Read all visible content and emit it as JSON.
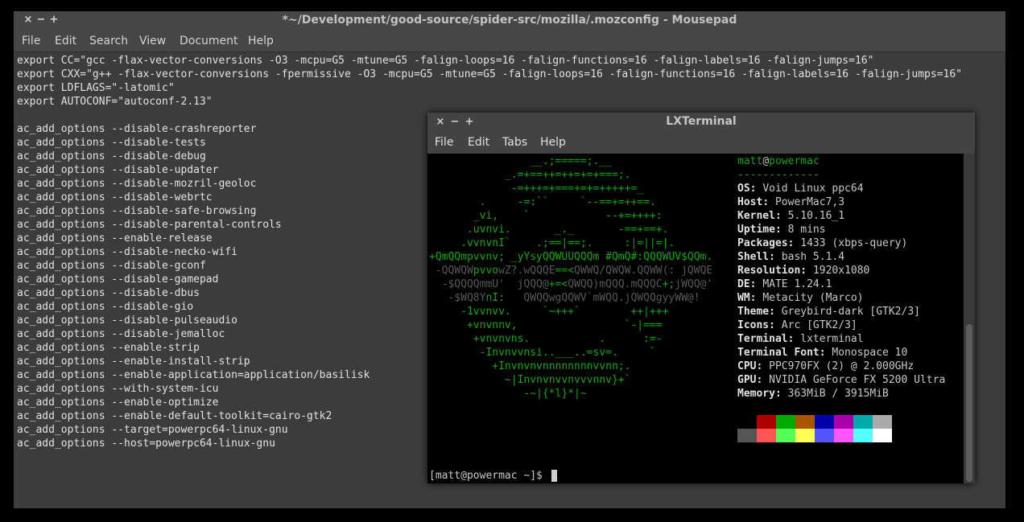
{
  "editor_window": {
    "title": "*~/Development/good-source/spider-src/mozilla/.mozconfig - Mousepad",
    "controls": [
      "×",
      "−",
      "+"
    ],
    "menu": [
      "File",
      "Edit",
      "Search",
      "View",
      "Document",
      "Help"
    ],
    "lines": [
      "export CC=\"gcc -flax-vector-conversions -O3 -mcpu=G5 -mtune=G5 -falign-loops=16 -falign-functions=16 -falign-labels=16 -falign-jumps=16\"",
      "export CXX=\"g++ -flax-vector-conversions -fpermissive -O3 -mcpu=G5 -mtune=G5 -falign-loops=16 -falign-functions=16 -falign-labels=16 -falign-jumps=16\"",
      "export LDFLAGS=\"-latomic\"",
      "export AUTOCONF=\"autoconf-2.13\"",
      "",
      "ac_add_options --disable-crashreporter",
      "ac_add_options --disable-tests",
      "ac_add_options --disable-debug",
      "ac_add_options --disable-updater",
      "ac_add_options --disable-mozril-geoloc",
      "ac_add_options --disable-webrtc",
      "ac_add_options --disable-safe-browsing",
      "ac_add_options --disable-parental-controls",
      "ac_add_options --enable-release",
      "ac_add_options --disable-necko-wifi",
      "ac_add_options --disable-gconf",
      "ac_add_options --disable-gamepad",
      "ac_add_options --disable-dbus",
      "ac_add_options --disable-gio",
      "ac_add_options --disable-pulseaudio",
      "ac_add_options --disable-jemalloc",
      "ac_add_options --enable-strip",
      "ac_add_options --enable-install-strip",
      "ac_add_options --enable-application=application/basilisk",
      "ac_add_options --with-system-icu",
      "ac_add_options --enable-optimize",
      "ac_add_options --enable-default-toolkit=cairo-gtk2",
      "ac_add_options --target=powerpc64-linux-gnu",
      "ac_add_options --host=powerpc64-linux-gnu"
    ]
  },
  "terminal_window": {
    "title": "LXTerminal",
    "controls": [
      "×",
      "−",
      "+"
    ],
    "menu": [
      "File",
      "Edit",
      "Tabs",
      "Help"
    ],
    "ascii_art": [
      [
        [
          "g",
          "                __.;=====;.__"
        ]
      ],
      [
        [
          "g",
          "            _.=+==++=++=+=+===;."
        ]
      ],
      [
        [
          "g",
          "             -=+++=+===+=+=+++++=_"
        ]
      ],
      [
        [
          "g",
          "        .     -=:``     `--==+=++==."
        ]
      ],
      [
        [
          "g",
          "       _vi,    `            --+=++++:"
        ]
      ],
      [
        [
          "g",
          "      .uvnvi.       _._       -==+==+."
        ]
      ],
      [
        [
          "g",
          "     .vvnvnI`    .;==|==;.     :|=||=|."
        ]
      ],
      [
        [
          "g",
          "+QmQQm"
        ],
        [
          "g",
          "pvvnv; _yYsyQQWUUQQQm #QmQ#:QQQWUV$QQm."
        ]
      ],
      [
        [
          "dg",
          " -QQWQW"
        ],
        [
          "g",
          "pvvo"
        ],
        [
          "dg",
          "wZ?.wQQQE"
        ],
        [
          "g",
          "==<"
        ],
        [
          "dg",
          "QWWQ/QWQW.QQWW(: jQWQE"
        ]
      ],
      [
        [
          "dg",
          "  -$QQQQmmU'  jQQQ@"
        ],
        [
          "g",
          "+=<"
        ],
        [
          "dg",
          "QWQQ)mQQQ.mQQQC"
        ],
        [
          "g",
          "+;"
        ],
        [
          "dg",
          "jWQQ@'"
        ]
      ],
      [
        [
          "dg",
          "   -$WQ8Y"
        ],
        [
          "g",
          "nI:"
        ],
        [
          "dg",
          "   QWQQwgQQWV`mWQQ.jQWQQgyyWW@!"
        ]
      ],
      [
        [
          "g",
          "     -1vvnvv.     `~+++`        ++|+++"
        ]
      ],
      [
        [
          "g",
          "      +vnvnnv,                 `-|==="
        ]
      ],
      [
        [
          "g",
          "       +vnvnvns.           .      :=-"
        ]
      ],
      [
        [
          "g",
          "        -Invnvvnsi..___..=sv=.     `"
        ]
      ],
      [
        [
          "g",
          "          +Invnvnvnnnnnnnnvvnn;."
        ]
      ],
      [
        [
          "g",
          "            ~|Invnvnvvnvvvnnv}+`"
        ]
      ],
      [
        [
          "g",
          "               -~|{*l}*|~"
        ]
      ]
    ],
    "user": "matt",
    "at": "@",
    "host": "powermac",
    "separator": "-------------",
    "info": [
      {
        "key": "OS",
        "value": "Void Linux ppc64"
      },
      {
        "key": "Host",
        "value": "PowerMac7,3"
      },
      {
        "key": "Kernel",
        "value": "5.10.16_1"
      },
      {
        "key": "Uptime",
        "value": "8 mins"
      },
      {
        "key": "Packages",
        "value": "1433 (xbps-query)"
      },
      {
        "key": "Shell",
        "value": "bash 5.1.4"
      },
      {
        "key": "Resolution",
        "value": "1920x1080"
      },
      {
        "key": "DE",
        "value": "MATE 1.24.1"
      },
      {
        "key": "WM",
        "value": "Metacity (Marco)"
      },
      {
        "key": "Theme",
        "value": "Greybird-dark [GTK2/3]"
      },
      {
        "key": "Icons",
        "value": "Arc [GTK2/3]"
      },
      {
        "key": "Terminal",
        "value": "lxterminal"
      },
      {
        "key": "Terminal Font",
        "value": "Monospace 10"
      },
      {
        "key": "CPU",
        "value": "PPC970FX (2) @ 2.000GHz"
      },
      {
        "key": "GPU",
        "value": "NVIDIA GeForce FX 5200 Ultra"
      },
      {
        "key": "Memory",
        "value": "363MiB / 3915MiB"
      }
    ],
    "palette_top": [
      "#000000",
      "#aa0000",
      "#00aa00",
      "#aa5500",
      "#0000aa",
      "#aa00aa",
      "#00aaaa",
      "#aaaaaa"
    ],
    "palette_bottom": [
      "#555555",
      "#ff5555",
      "#55ff55",
      "#ffff55",
      "#5555ff",
      "#ff55ff",
      "#55ffff",
      "#ffffff"
    ],
    "prompt": "[matt@powermac ~]$ "
  }
}
